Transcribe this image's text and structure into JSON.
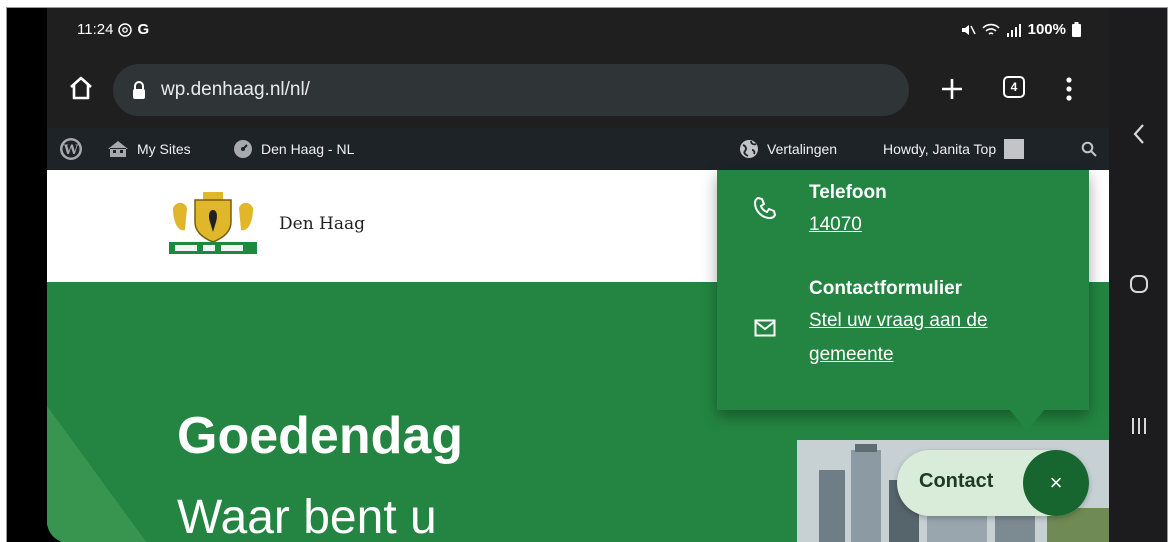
{
  "status_bar": {
    "time": "11:24",
    "google_glyph": "G",
    "battery": "100%"
  },
  "browser": {
    "url": "wp.denhaag.nl/nl/",
    "tab_count": "4"
  },
  "wp_admin_bar": {
    "my_sites": "My Sites",
    "site_name": "Den Haag - NL",
    "translations": "Vertalingen",
    "howdy": "Howdy, Janita Top"
  },
  "site": {
    "logo_text": "Den Haag"
  },
  "hero": {
    "greeting": "Goedendag",
    "subline": "Waar bent u"
  },
  "contact_panel": {
    "phone_label": "Telefoon",
    "phone_number": "14070",
    "form_label": "Contactformulier",
    "form_link_line1": "Stel uw vraag aan de",
    "form_link_line2": "gemeente"
  },
  "contact_button": {
    "label": "Contact",
    "close": "×"
  },
  "colors": {
    "brand_green": "#238541",
    "dark_green": "#17652f",
    "wp_bar": "#1d2327"
  }
}
